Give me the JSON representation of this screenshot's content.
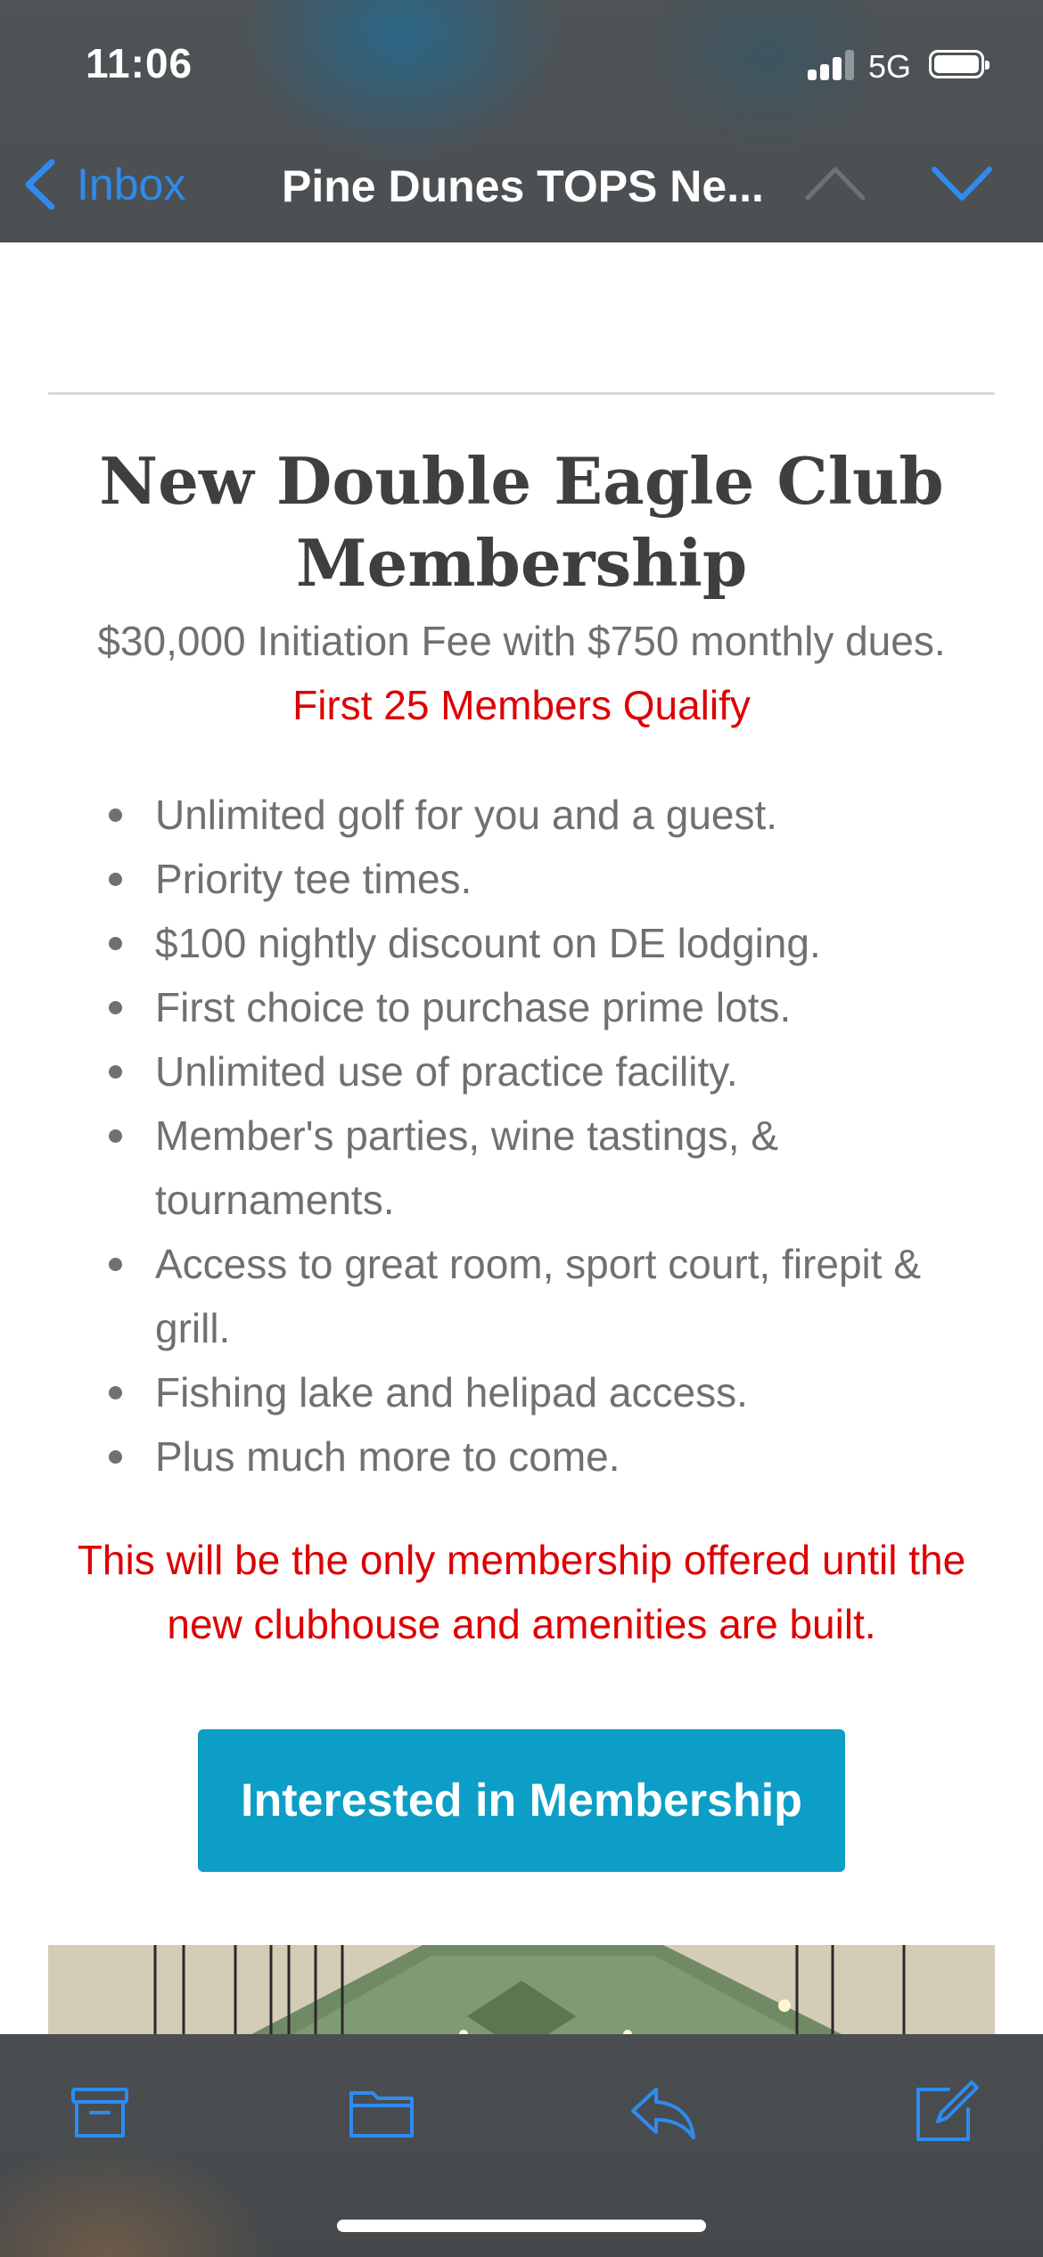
{
  "status_bar": {
    "time": "11:06",
    "network": "5G"
  },
  "nav": {
    "back_label": "Inbox",
    "title": "Pine Dunes TOPS Ne..."
  },
  "email": {
    "headline": "New Double Eagle Club Membership",
    "fee_text": "$30,000 Initiation Fee with $750 monthly dues.",
    "qualify_text": "First 25 Members Qualify",
    "benefits": [
      "Unlimited golf for you and a guest.",
      "Priority tee times.",
      "$100 nightly discount on DE lodging.",
      "First choice to purchase prime lots.",
      "Unlimited use of practice facility.",
      "Member's parties, wine tastings, & tournaments.",
      "Access to great room, sport court, firepit & grill.",
      "Fishing lake and helipad access.",
      "Plus much more to come."
    ],
    "notice": "This will be the only membership offered until the new clubhouse and amenities are built.",
    "cta_label": "Interested in Membership"
  },
  "toolbar": {
    "items": [
      "archive-icon",
      "folder-icon",
      "reply-icon",
      "compose-icon"
    ]
  },
  "colors": {
    "accent_blue": "#2e8bf0",
    "alert_red": "#dd0000",
    "button_teal": "#0c9ec7",
    "body_text": "#707070",
    "headline_text": "#3f3f3f"
  }
}
